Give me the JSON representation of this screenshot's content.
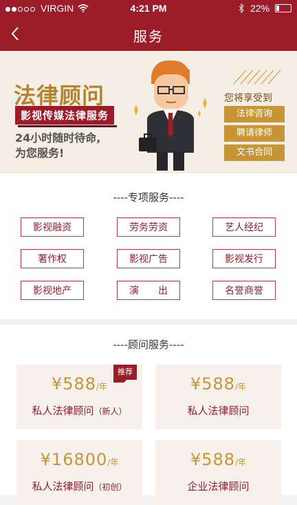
{
  "status": {
    "carrier": "VIRGIN",
    "time": "4:21 PM",
    "battery": "22%",
    "battery_level": 0.22
  },
  "nav": {
    "title": "服务"
  },
  "banner": {
    "title": "法律顾问",
    "tag": "影视传媒法律服务",
    "slogan1": "24小时随时待命,",
    "slogan2": "为您服务!",
    "enjoy": "您将享受到",
    "benefits": [
      "法律咨询",
      "聘请律师",
      "文书合同"
    ]
  },
  "special": {
    "title": "----专项服务----",
    "items": [
      "影视融资",
      "劳务劳资",
      "艺人经纪",
      "著作权",
      "影视广告",
      "影视发行",
      "影视地产",
      "演　　出",
      "名誉商誉"
    ]
  },
  "advisor": {
    "title": "----顾问服务----",
    "cards": [
      {
        "price": "¥588",
        "unit": "/年",
        "name": "私人法律顾问",
        "note": "（新人）",
        "badge": "推荐"
      },
      {
        "price": "¥588",
        "unit": "/年",
        "name": "私人法律顾问",
        "note": "",
        "badge": ""
      },
      {
        "price": "¥16800",
        "unit": "/年",
        "name": "私人法律顾问",
        "note": "（初创）",
        "badge": ""
      },
      {
        "price": "¥588",
        "unit": "/年",
        "name": "企业法律顾问",
        "note": "",
        "badge": ""
      }
    ]
  },
  "icons": [
    "back-chevron-icon",
    "wifi-icon",
    "bluetooth-icon",
    "battery-icon",
    "lawyer-illustration"
  ],
  "colors": {
    "brand": "#9d1c2a",
    "gold": "#c79535",
    "banner_bg": "#f5eee4",
    "card_bg": "#f6f1ea"
  }
}
